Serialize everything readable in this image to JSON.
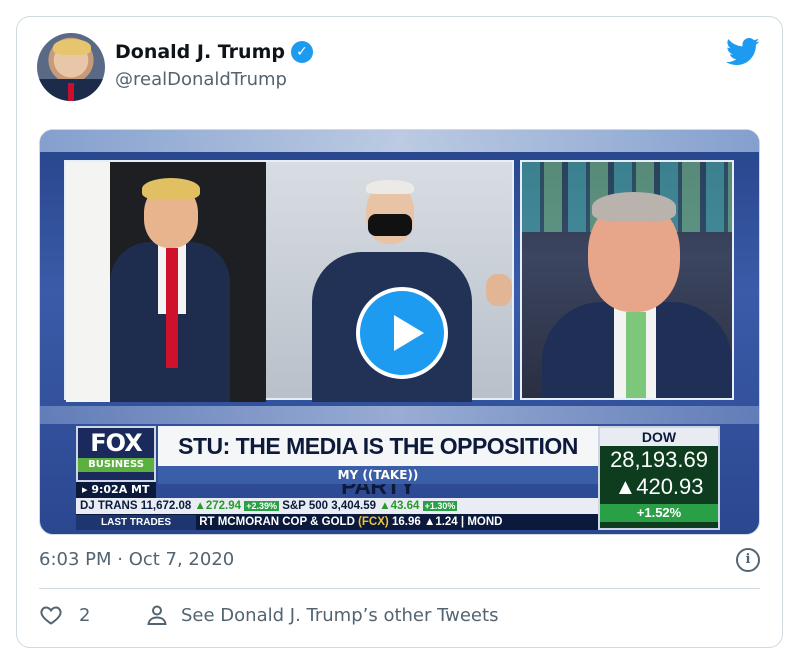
{
  "tweet": {
    "author_name": "Donald J. Trump",
    "author_handle": "@realDonaldTrump",
    "verified": true,
    "timestamp": "6:03 PM · Oct 7, 2020",
    "like_count": "2",
    "other_tweets_label": "See Donald J. Trump’s other Tweets"
  },
  "video": {
    "fox_logo": "FOX",
    "fox_sub": "BUSINESS",
    "headline": "STU: THE MEDIA IS THE OPPOSITION PARTY",
    "segment": "MY ((TAKE))",
    "clock": "▸ 9:02A MT",
    "ticker_line1": {
      "dj_label": "DJ TRANS",
      "dj_value": "11,672.08",
      "dj_change": "▲272.94",
      "dj_pct": "+2.39%",
      "sp_label": "S&P 500",
      "sp_value": "3,404.59",
      "sp_change": "▲43.64",
      "sp_pct": "+1.30%"
    },
    "ticker_line2": {
      "label": "LAST TRADES",
      "company": "RT MCMORAN COP & GOLD",
      "symbol": "(FCX)",
      "price": "16.96",
      "change": "▲1.24",
      "next": "| MOND"
    },
    "dow": {
      "label": "DOW",
      "value": "28,193.69",
      "change": "▲420.93",
      "pct": "+1.52%"
    }
  },
  "icons": {
    "verified": "verified-badge-icon",
    "brand": "twitter-bird-icon",
    "play": "play-icon",
    "info": "info-icon",
    "like": "heart-icon",
    "profile": "person-icon"
  },
  "colors": {
    "accent": "#1d9bf0",
    "text_primary": "#0f1419",
    "text_secondary": "#536471",
    "border": "#cfd9de"
  }
}
